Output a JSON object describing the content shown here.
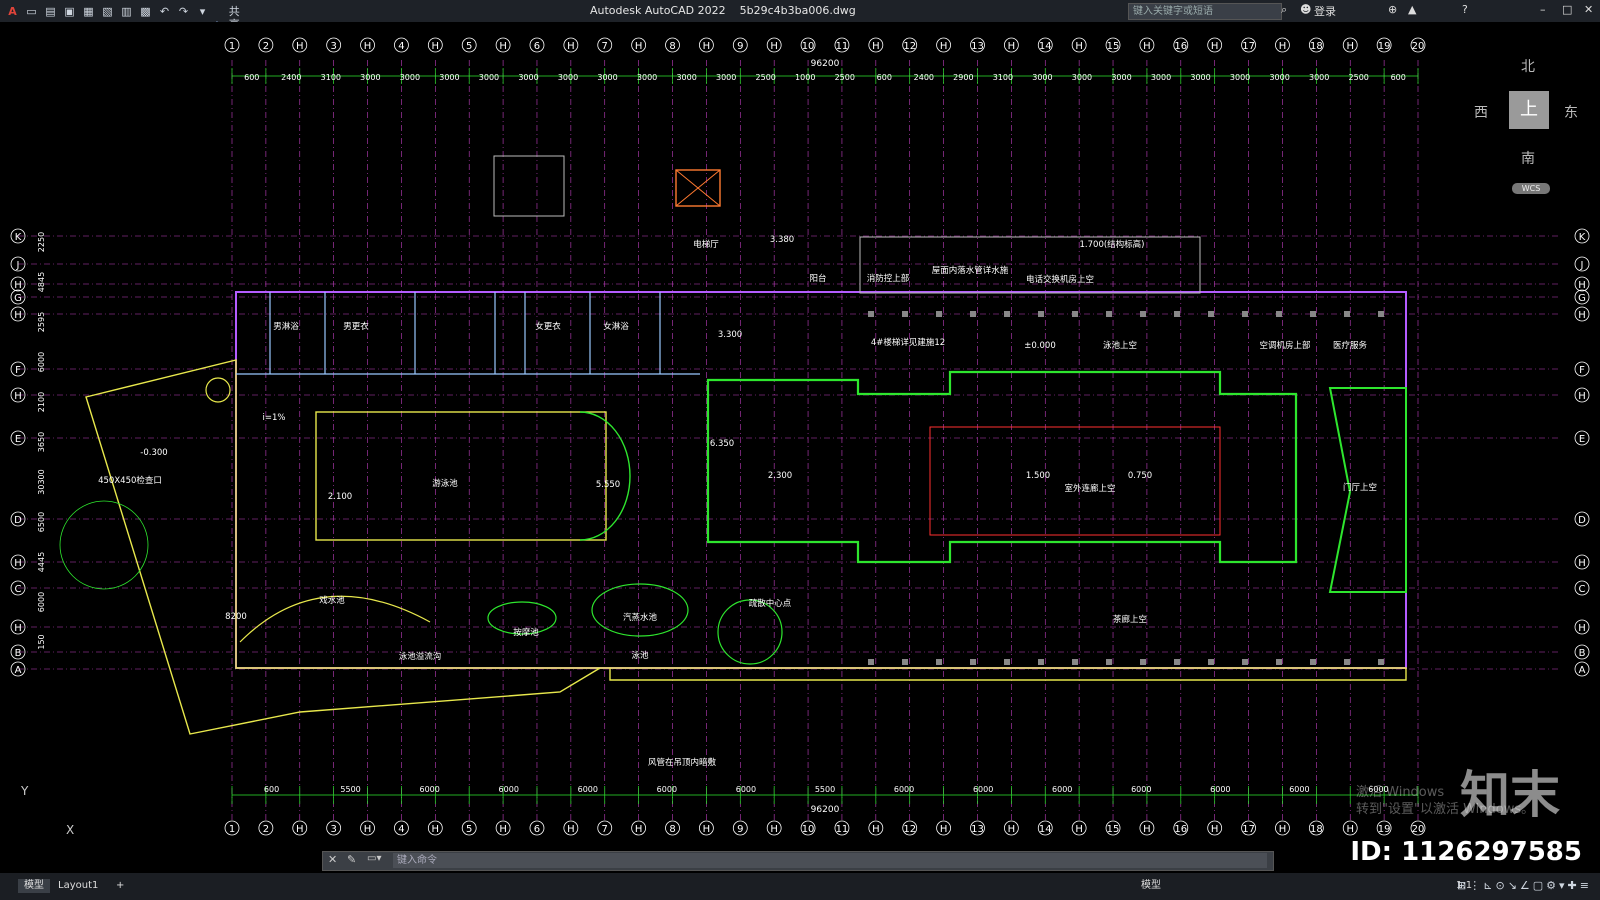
{
  "app": {
    "title": "Autodesk AutoCAD 2022",
    "file": "5b29c4b3ba006.dwg",
    "share_label": "共享",
    "search_placeholder": "键入关键字或短语",
    "login_label": "登录"
  },
  "commandline": {
    "placeholder": "键入命令"
  },
  "layout_tabs": [
    "模型",
    "Layout1",
    "+"
  ],
  "statusbar": {
    "model_label": "模型",
    "scale_label": "1:1"
  },
  "viewcube": {
    "north": "北",
    "south": "南",
    "east": "东",
    "west": "西",
    "face": "上",
    "wcs": "WCS"
  },
  "ucs": {
    "x_label": "X",
    "y_label": "Y"
  },
  "watermark": {
    "brand": "知末",
    "id_label": "ID: 1126297585",
    "activate_line1": "激活 Windows",
    "activate_line2": "转到\"设置\"以激活 Windows。"
  },
  "drawing": {
    "grid_top": [
      "1",
      "2",
      "H",
      "3",
      "H",
      "4",
      "H",
      "5",
      "H",
      "6",
      "H",
      "7",
      "H",
      "8",
      "H",
      "9",
      "H",
      "10",
      "11",
      "H",
      "12",
      "H",
      "13",
      "H",
      "14",
      "H",
      "15",
      "H",
      "16",
      "H",
      "17",
      "H",
      "18",
      "H",
      "19",
      "20"
    ],
    "grid_left": [
      "K",
      "J",
      "H",
      "G",
      "H",
      "F",
      "H",
      "E",
      "D",
      "H",
      "C",
      "H",
      "B",
      "A"
    ],
    "total_dim": "96200",
    "top_dims": [
      "600",
      "2400",
      "3100",
      "3000",
      "3000",
      "3000",
      "3000",
      "3000",
      "3000",
      "3000",
      "3000",
      "3000",
      "3000",
      "2500",
      "1000",
      "2500",
      "600",
      "2400",
      "2900",
      "3100",
      "3000",
      "3000",
      "3000",
      "3000",
      "3000",
      "3000",
      "3000",
      "3000",
      "2500",
      "600"
    ],
    "bottom_dims": [
      "600",
      "5500",
      "6000",
      "6000",
      "6000",
      "6000",
      "6000",
      "5500",
      "6000",
      "6000",
      "6000",
      "6000",
      "6000",
      "6000",
      "6000"
    ],
    "left_dims": [
      "2250",
      "4845",
      "2595",
      "6000",
      "2100",
      "3650",
      "30300",
      "6500",
      "4445",
      "6000",
      "150"
    ],
    "room_labels": [
      {
        "t": "男淋浴"
      },
      {
        "t": "男更衣"
      },
      {
        "t": "女更衣"
      },
      {
        "t": "女淋浴"
      },
      {
        "t": "泳池上空"
      },
      {
        "t": "游泳池"
      },
      {
        "t": "戏水池"
      },
      {
        "t": "按摩池"
      },
      {
        "t": "汽蒸水池"
      },
      {
        "t": "泳池"
      },
      {
        "t": "疏散中心点"
      },
      {
        "t": "电梯厅"
      },
      {
        "t": "消防控上部"
      },
      {
        "t": "阳台"
      },
      {
        "t": "空调机房上部"
      },
      {
        "t": "医疗服务"
      },
      {
        "t": "门厅上空"
      },
      {
        "t": "茶廊上空"
      },
      {
        "t": "4#楼梯详见建施12"
      },
      {
        "t": "屋面内落水管详水施"
      },
      {
        "t": "电话交换机房上空"
      },
      {
        "t": "±0.000"
      },
      {
        "t": "3.300"
      },
      {
        "t": "-0.300"
      },
      {
        "t": "2.100"
      },
      {
        "t": "2.300"
      },
      {
        "t": "1.500"
      },
      {
        "t": "0.750"
      },
      {
        "t": "1.700(结构标高)"
      },
      {
        "t": "3.380"
      },
      {
        "t": "室外连廊上空"
      },
      {
        "t": "5.550"
      },
      {
        "t": "6.350"
      },
      {
        "t": "风管在吊顶内暗敷"
      },
      {
        "t": "i=1%"
      },
      {
        "t": "450X450检查口"
      },
      {
        "t": "泳池溢流沟"
      },
      {
        "t": "8200"
      }
    ]
  }
}
